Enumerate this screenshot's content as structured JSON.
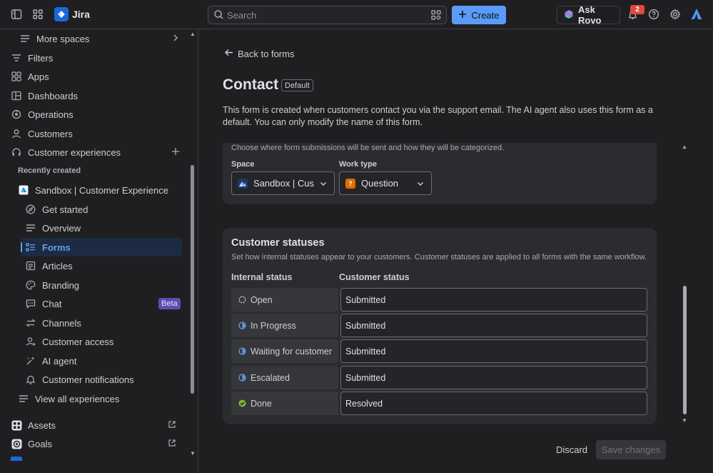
{
  "topbar": {
    "app_name": "Jira",
    "search_placeholder": "Search",
    "create_label": "Create",
    "ask_rovo_label": "Ask Rovo",
    "notification_count": "2"
  },
  "sidebar": {
    "items": [
      {
        "label": "More spaces",
        "icon": "list-icon"
      },
      {
        "label": "Filters",
        "icon": "filter-icon"
      },
      {
        "label": "Apps",
        "icon": "apps-icon"
      },
      {
        "label": "Dashboards",
        "icon": "dashboard-icon"
      },
      {
        "label": "Operations",
        "icon": "operations-icon"
      },
      {
        "label": "Customers",
        "icon": "person-icon"
      },
      {
        "label": "Customer experiences",
        "icon": "headset-icon"
      }
    ],
    "recently_created_title": "Recently created",
    "project": {
      "label": "Sandbox | Customer Experience"
    },
    "sub_items": [
      {
        "label": "Get started",
        "icon": "compass-icon"
      },
      {
        "label": "Overview",
        "icon": "list-icon"
      },
      {
        "label": "Forms",
        "icon": "form-icon"
      },
      {
        "label": "Articles",
        "icon": "article-icon"
      },
      {
        "label": "Branding",
        "icon": "palette-icon"
      },
      {
        "label": "Chat",
        "icon": "chat-icon",
        "badge": "Beta"
      },
      {
        "label": "Channels",
        "icon": "arrows-icon"
      },
      {
        "label": "Customer access",
        "icon": "person-plus-icon"
      },
      {
        "label": "AI agent",
        "icon": "sparkle-icon"
      },
      {
        "label": "Customer notifications",
        "icon": "bell-icon"
      }
    ],
    "view_all": "View all experiences",
    "bottom_items": [
      {
        "label": "Assets",
        "icon": "assets-icon"
      },
      {
        "label": "Goals",
        "icon": "goals-icon"
      }
    ]
  },
  "main": {
    "back_label": "Back to forms",
    "title": "Contact",
    "default_badge": "Default",
    "description": "This form is created when customers contact you via the support email. The AI agent also uses this form as a default. You can only modify the name of this form.",
    "routing": {
      "description": "Choose where form submissions will be sent and how they will be categorized.",
      "space_label": "Space",
      "space_value": "Sandbox | Cus",
      "work_type_label": "Work type",
      "work_type_value": "Question"
    },
    "statuses": {
      "title": "Customer statuses",
      "description": "Set how internal statuses appear to your customers. Customer statuses are applied to all forms with the same workflow.",
      "internal_header": "Internal status",
      "customer_header": "Customer status",
      "rows": [
        {
          "internal": "Open",
          "customer": "Submitted",
          "icon": "open-status-icon"
        },
        {
          "internal": "In Progress",
          "customer": "Submitted",
          "icon": "in-progress-status-icon"
        },
        {
          "internal": "Waiting for customer",
          "customer": "Submitted",
          "icon": "in-progress-status-icon"
        },
        {
          "internal": "Escalated",
          "customer": "Submitted",
          "icon": "in-progress-status-icon"
        },
        {
          "internal": "Done",
          "customer": "Resolved",
          "icon": "done-status-icon"
        }
      ]
    },
    "discard_label": "Discard",
    "save_label": "Save changes"
  },
  "colors": {
    "accent": "#5b9bf8",
    "active_nav": "#669df1",
    "background": "#1f1f21",
    "card": "#2b2c2f",
    "done_green": "#6a9a23",
    "badge_red": "#e2483d",
    "beta_purple": "#5e4db2"
  }
}
